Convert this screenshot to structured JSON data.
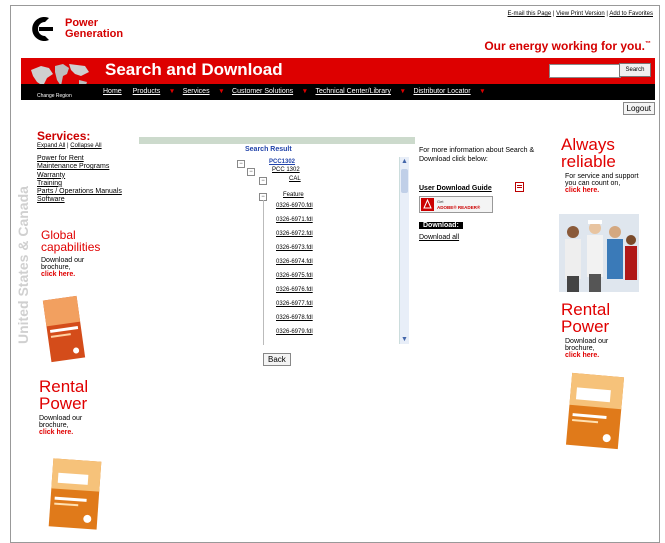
{
  "header": {
    "top_links": [
      "E-mail this Page",
      "View Print Version",
      "Add to Favorites"
    ],
    "brand_line1": "Power",
    "brand_line2": "Generation",
    "tagline": "Our energy working for you.",
    "trademark": "™"
  },
  "banner": {
    "title": "Search and Download",
    "search_placeholder": "",
    "search_button": "Search"
  },
  "nav": {
    "region_label": "Change Region",
    "items": [
      "Home",
      "Products",
      "Services",
      "Customer Solutions",
      "Technical Center/Library",
      "Distributor Locator"
    ]
  },
  "logout_label": "Logout",
  "vertical_text": "United States & Canada",
  "services": {
    "title": "Services:",
    "expand_all": "Expand All",
    "separator": "|",
    "collapse_all": "Collapse All",
    "items": [
      "Power for Rent",
      "Maintenance Programs",
      "Warranty",
      "Training",
      "Parts / Operations Manuals",
      "Software"
    ]
  },
  "left_promos": [
    {
      "title_line1": "Global",
      "title_line2": "capabilities",
      "text": "Download our brochure,",
      "link": "click here."
    },
    {
      "title_line1": "Rental",
      "title_line2": "Power",
      "text": "Download our brochure,",
      "link": "click here."
    }
  ],
  "search_result": {
    "header": "Search Result",
    "tree": {
      "root": "PCC1302",
      "child": "PCC 1302",
      "grandchild": "CAL",
      "feature": "Feature",
      "files": [
        "0326-6970.fdl",
        "0326-6971.fdl",
        "0326-6972.fdl",
        "0326-6973.fdl",
        "0326-6974.fdl",
        "0326-6975.fdl",
        "0326-6976.fdl",
        "0326-6977.fdl",
        "0326-6978.fdl",
        "0326-6979.fdl"
      ]
    },
    "back_button": "Back"
  },
  "info": {
    "text": "For more information about Search & Download click below:",
    "user_guide": "User Download Guide",
    "adobe_get": "Get",
    "adobe_product": "ADOBE® READER®",
    "download_label": "Download:",
    "download_all": "Download all"
  },
  "right_promos": {
    "always_line1": "Always",
    "always_line2": "reliable",
    "always_text": "For service and support you can count on,",
    "always_link": "click here.",
    "rental_line1": "Rental",
    "rental_line2": "Power",
    "rental_text": "Download our brochure,",
    "rental_link": "click here."
  },
  "colors": {
    "brand_red": "#dd0000",
    "nav_black": "#000000",
    "result_blue": "#2244aa"
  }
}
